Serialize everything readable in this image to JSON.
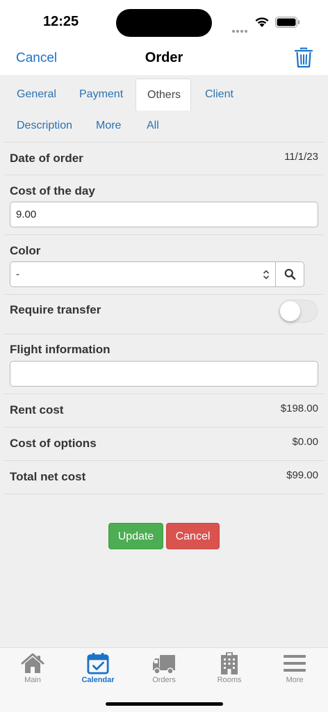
{
  "status": {
    "time": "12:25"
  },
  "nav": {
    "cancel": "Cancel",
    "title": "Order"
  },
  "tabs": [
    {
      "label": "General"
    },
    {
      "label": "Payment"
    },
    {
      "label": "Others"
    },
    {
      "label": "Client"
    },
    {
      "label": "Description"
    },
    {
      "label": "More"
    },
    {
      "label": "All"
    }
  ],
  "active_tab": "Others",
  "form": {
    "date_of_order": {
      "label": "Date of order",
      "value": "11/1/23"
    },
    "cost_of_day": {
      "label": "Cost of the day",
      "value": "9.00"
    },
    "color": {
      "label": "Color",
      "value": "-"
    },
    "require_transfer": {
      "label": "Require transfer",
      "on": false
    },
    "flight_information": {
      "label": "Flight information",
      "value": ""
    },
    "rent_cost": {
      "label": "Rent cost",
      "value": "$198.00"
    },
    "cost_of_options": {
      "label": "Cost of options",
      "value": "$0.00"
    },
    "total_net_cost": {
      "label": "Total net cost",
      "value": "$99.00"
    }
  },
  "buttons": {
    "update": "Update",
    "cancel": "Cancel"
  },
  "tabbar": [
    {
      "label": "Main",
      "icon": "home-icon"
    },
    {
      "label": "Calendar",
      "icon": "calendar-icon"
    },
    {
      "label": "Orders",
      "icon": "truck-icon"
    },
    {
      "label": "Rooms",
      "icon": "building-icon"
    },
    {
      "label": "More",
      "icon": "menu-icon"
    }
  ],
  "active_tabbar": "Calendar",
  "colors": {
    "accent": "#1a73c8",
    "tab_link": "#2b72b0",
    "update_button": "#4cad52",
    "cancel_button": "#d9534f",
    "background": "#efefef"
  }
}
